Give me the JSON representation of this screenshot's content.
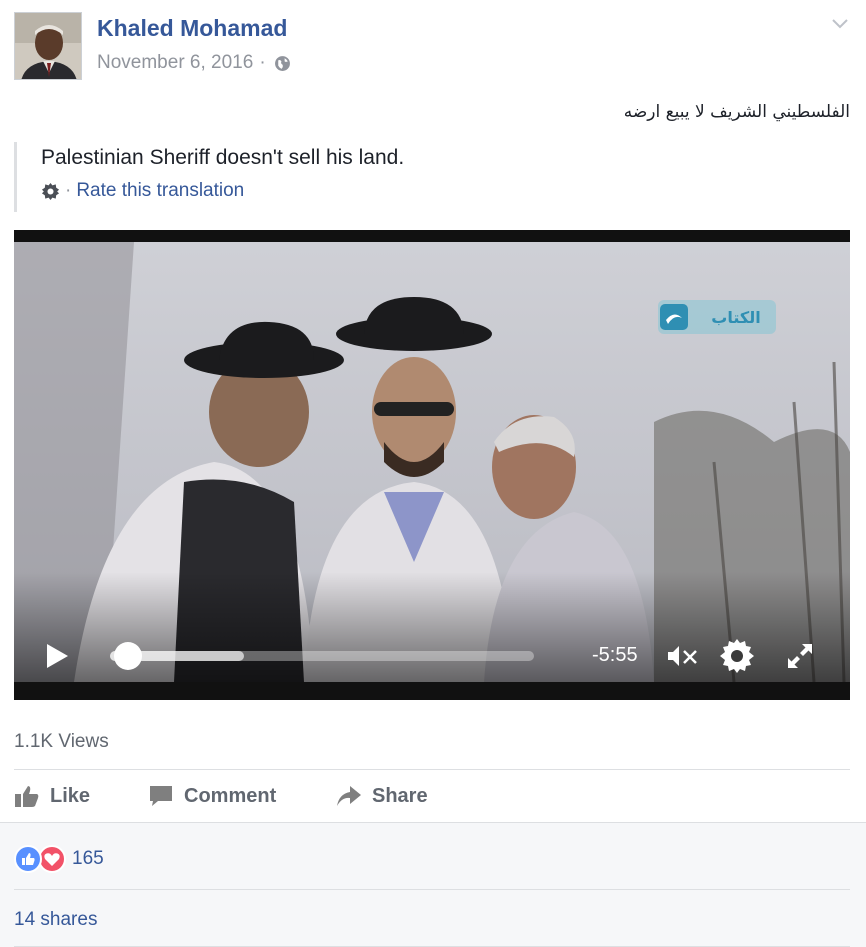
{
  "post": {
    "author": "Khaled Mohamad",
    "date": "November 6, 2016",
    "separator": "·",
    "privacy_icon": "globe-icon",
    "menu_icon": "chevron-down-icon",
    "original_text": "الفلسطيني الشريف لا يبيع ارضه",
    "translation": {
      "text": "Palestinian Sheriff doesn't sell his land.",
      "separator": "·",
      "rate_label": "Rate this translation",
      "icon": "gear-icon"
    }
  },
  "video": {
    "channel_logo_text": "الكتاب",
    "progress": 0.0,
    "buffered": 0.32,
    "time_remaining": "-5:55",
    "controls": {
      "play_icon": "play-icon",
      "mute_icon": "muted-speaker-icon",
      "settings_icon": "gear-icon",
      "fullscreen_icon": "expand-icon"
    }
  },
  "stats": {
    "views": "1.1K Views",
    "reactions_count": "165",
    "reaction_types": [
      "like",
      "love"
    ],
    "shares": "14 shares"
  },
  "actions": {
    "like": "Like",
    "comment": "Comment",
    "share": "Share"
  },
  "colors": {
    "link_blue": "#365899",
    "text_gray": "#616770",
    "meta_gray": "#90949c",
    "like_blue": "#5890ff",
    "love_red": "#f25268"
  }
}
